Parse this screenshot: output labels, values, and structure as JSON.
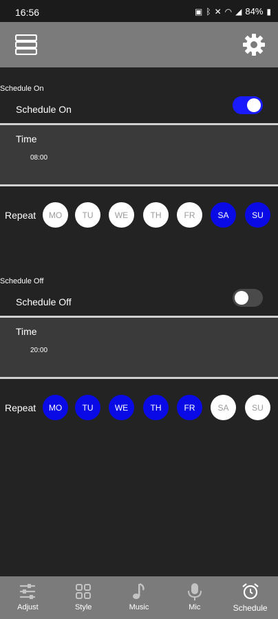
{
  "status_bar": {
    "time": "16:56",
    "battery": "84%"
  },
  "schedule_on": {
    "section_label": "Schedule On",
    "toggle_label": "Schedule On",
    "enabled": true,
    "time_label": "Time",
    "time_value": "08:00",
    "repeat_label": "Repeat",
    "days": [
      {
        "label": "MO",
        "selected": false
      },
      {
        "label": "TU",
        "selected": false
      },
      {
        "label": "WE",
        "selected": false
      },
      {
        "label": "TH",
        "selected": false
      },
      {
        "label": "FR",
        "selected": false
      },
      {
        "label": "SA",
        "selected": true
      },
      {
        "label": "SU",
        "selected": true
      }
    ]
  },
  "schedule_off": {
    "section_label": "Schedule Off",
    "toggle_label": "Schedule Off",
    "enabled": false,
    "time_label": "Time",
    "time_value": "20:00",
    "repeat_label": "Repeat",
    "days": [
      {
        "label": "MO",
        "selected": true
      },
      {
        "label": "TU",
        "selected": true
      },
      {
        "label": "WE",
        "selected": true
      },
      {
        "label": "TH",
        "selected": true
      },
      {
        "label": "FR",
        "selected": true
      },
      {
        "label": "SA",
        "selected": false
      },
      {
        "label": "SU",
        "selected": false
      }
    ]
  },
  "bottom_nav": [
    {
      "label": "Adjust",
      "icon": "sliders-icon",
      "active": false
    },
    {
      "label": "Style",
      "icon": "grid-icon",
      "active": false
    },
    {
      "label": "Music",
      "icon": "music-note-icon",
      "active": false
    },
    {
      "label": "Mic",
      "icon": "microphone-icon",
      "active": false
    },
    {
      "label": "Schedule",
      "icon": "alarm-clock-icon",
      "active": true
    }
  ],
  "colors": {
    "accent": "#1a1aff",
    "day_selected": "#0a0ae6",
    "toolbar": "#7b7b7b",
    "background": "#232323"
  }
}
